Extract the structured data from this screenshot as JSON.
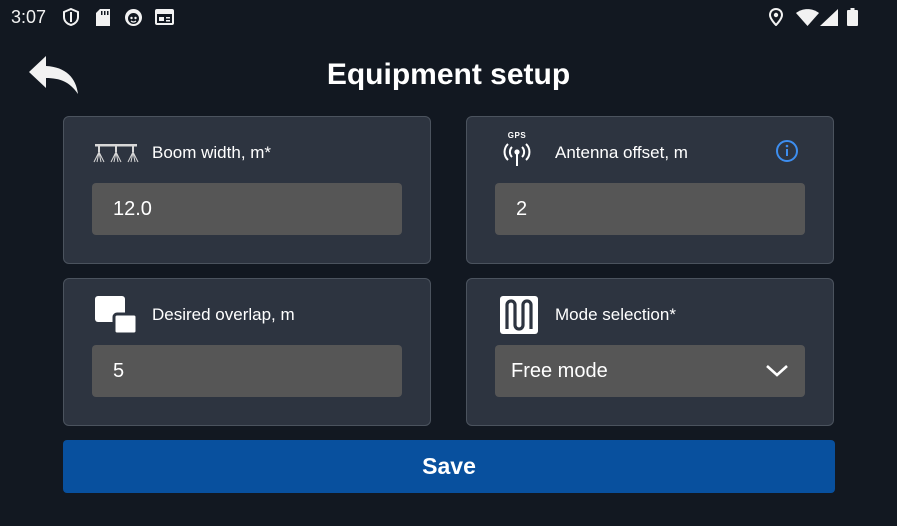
{
  "status_bar": {
    "time": "3:07",
    "left_icons": [
      "shield-icon",
      "sd-card-icon",
      "face-icon",
      "news-icon"
    ],
    "right_icons": [
      "location-icon",
      "wifi-icon",
      "signal-icon",
      "battery-icon"
    ]
  },
  "header": {
    "title": "Equipment setup",
    "back_icon": "back-arrow-icon"
  },
  "cards": {
    "boom_width": {
      "label": "Boom width, m*",
      "value": "12.0",
      "icon": "boom-sprayer-icon"
    },
    "antenna_offset": {
      "label": "Antenna offset, m",
      "value": "2",
      "icon": "gps-antenna-icon",
      "icon_caption": "GPS",
      "info_icon": "info-icon"
    },
    "desired_overlap": {
      "label": "Desired overlap, m",
      "value": "5",
      "icon": "overlap-icon"
    },
    "mode_selection": {
      "label": "Mode selection*",
      "value": "Free mode",
      "icon": "zigzag-path-icon",
      "dropdown_icon": "chevron-down-icon"
    }
  },
  "save_button": {
    "label": "Save"
  },
  "colors": {
    "background": "#121821",
    "card": "#2d3440",
    "card_border": "#4b535e",
    "field": "#565656",
    "accent": "#08509e",
    "info": "#3d8ef0"
  }
}
